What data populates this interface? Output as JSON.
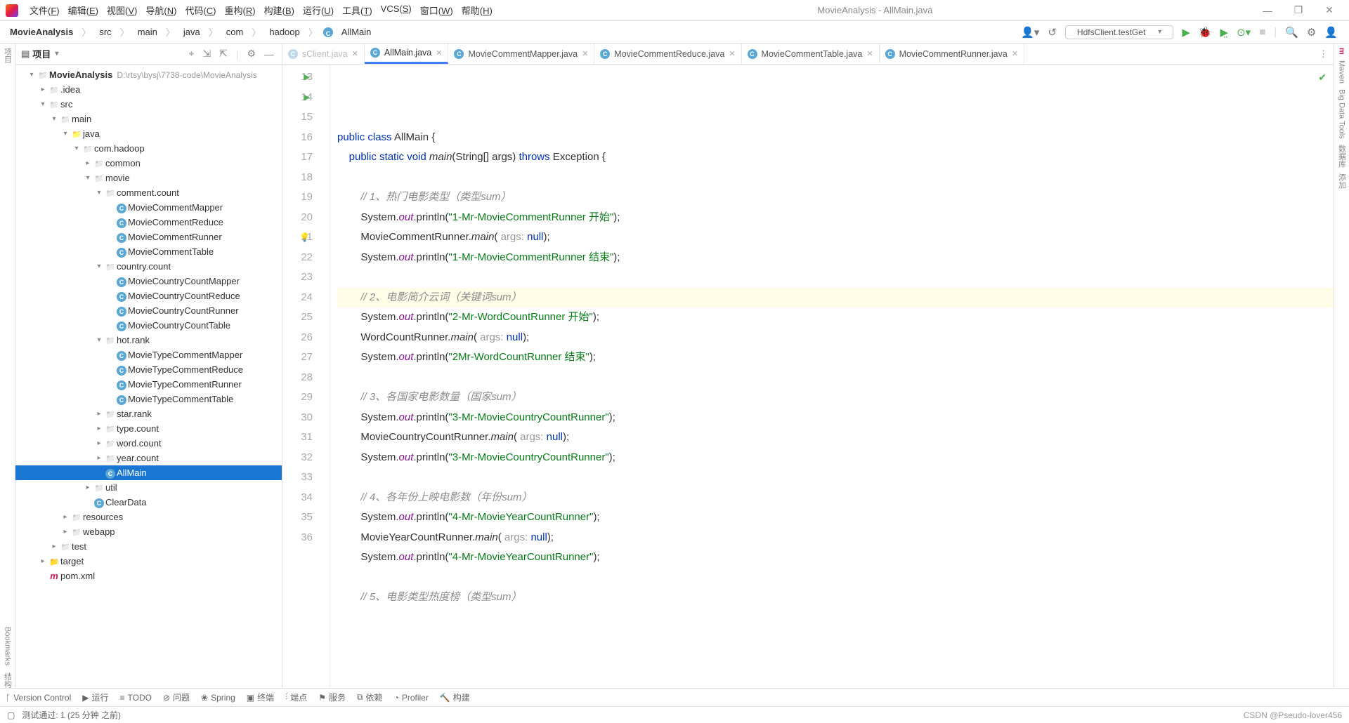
{
  "window": {
    "title": "MovieAnalysis - AllMain.java"
  },
  "menu": [
    "文件(F)",
    "编辑(E)",
    "视图(V)",
    "导航(N)",
    "代码(C)",
    "重构(R)",
    "构建(B)",
    "运行(U)",
    "工具(T)",
    "VCS(S)",
    "窗口(W)",
    "帮助(H)"
  ],
  "breadcrumbs": [
    "MovieAnalysis",
    "src",
    "main",
    "java",
    "com",
    "hadoop",
    "AllMain"
  ],
  "runConfig": "HdfsClient.testGet",
  "project": {
    "header": "项目",
    "root": {
      "name": "MovieAnalysis",
      "path": "D:\\rtsy\\bysj\\7738-code\\MovieAnalysis"
    },
    "tree": [
      {
        "d": 1,
        "a": "▾",
        "i": "fold",
        "t": "MovieAnalysis",
        "bold": true,
        "path": "D:\\rtsy\\bysj\\7738-code\\MovieAnalysis"
      },
      {
        "d": 2,
        "a": "▸",
        "i": "fold",
        "t": ".idea"
      },
      {
        "d": 2,
        "a": "▾",
        "i": "fold",
        "t": "src"
      },
      {
        "d": 3,
        "a": "▾",
        "i": "fold",
        "t": "main"
      },
      {
        "d": 4,
        "a": "▾",
        "i": "foldb",
        "t": "java"
      },
      {
        "d": 5,
        "a": "▾",
        "i": "fold",
        "t": "com.hadoop"
      },
      {
        "d": 6,
        "a": "▸",
        "i": "fold",
        "t": "common"
      },
      {
        "d": 6,
        "a": "▾",
        "i": "fold",
        "t": "movie"
      },
      {
        "d": 7,
        "a": "▾",
        "i": "fold",
        "t": "comment.count"
      },
      {
        "d": 8,
        "a": "",
        "i": "jcls",
        "t": "MovieCommentMapper"
      },
      {
        "d": 8,
        "a": "",
        "i": "jcls",
        "t": "MovieCommentReduce"
      },
      {
        "d": 8,
        "a": "",
        "i": "jcls",
        "t": "MovieCommentRunner"
      },
      {
        "d": 8,
        "a": "",
        "i": "jcls",
        "t": "MovieCommentTable"
      },
      {
        "d": 7,
        "a": "▾",
        "i": "fold",
        "t": "country.count"
      },
      {
        "d": 8,
        "a": "",
        "i": "jcls",
        "t": "MovieCountryCountMapper"
      },
      {
        "d": 8,
        "a": "",
        "i": "jcls",
        "t": "MovieCountryCountReduce"
      },
      {
        "d": 8,
        "a": "",
        "i": "jcls",
        "t": "MovieCountryCountRunner"
      },
      {
        "d": 8,
        "a": "",
        "i": "jcls",
        "t": "MovieCountryCountTable"
      },
      {
        "d": 7,
        "a": "▾",
        "i": "fold",
        "t": "hot.rank"
      },
      {
        "d": 8,
        "a": "",
        "i": "jcls",
        "t": "MovieTypeCommentMapper"
      },
      {
        "d": 8,
        "a": "",
        "i": "jcls",
        "t": "MovieTypeCommentReduce"
      },
      {
        "d": 8,
        "a": "",
        "i": "jcls",
        "t": "MovieTypeCommentRunner"
      },
      {
        "d": 8,
        "a": "",
        "i": "jcls",
        "t": "MovieTypeCommentTable"
      },
      {
        "d": 7,
        "a": "▸",
        "i": "fold",
        "t": "star.rank"
      },
      {
        "d": 7,
        "a": "▸",
        "i": "fold",
        "t": "type.count"
      },
      {
        "d": 7,
        "a": "▸",
        "i": "fold",
        "t": "word.count"
      },
      {
        "d": 7,
        "a": "▸",
        "i": "fold",
        "t": "year.count"
      },
      {
        "d": 7,
        "a": "",
        "i": "jcls",
        "t": "AllMain",
        "sel": true
      },
      {
        "d": 6,
        "a": "▸",
        "i": "fold",
        "t": "util"
      },
      {
        "d": 6,
        "a": "",
        "i": "jcls",
        "t": "ClearData"
      },
      {
        "d": 4,
        "a": "▸",
        "i": "fold",
        "t": "resources"
      },
      {
        "d": 4,
        "a": "▸",
        "i": "fold",
        "t": "webapp"
      },
      {
        "d": 3,
        "a": "▸",
        "i": "fold",
        "t": "test"
      },
      {
        "d": 2,
        "a": "▸",
        "i": "foldt",
        "t": "target"
      },
      {
        "d": 2,
        "a": "",
        "i": "mvn",
        "t": "pom.xml"
      }
    ]
  },
  "tabs": [
    {
      "label": "sClient.java",
      "fade": true
    },
    {
      "label": "AllMain.java",
      "active": true
    },
    {
      "label": "MovieCommentMapper.java"
    },
    {
      "label": "MovieCommentReduce.java"
    },
    {
      "label": "MovieCommentTable.java"
    },
    {
      "label": "MovieCommentRunner.java"
    }
  ],
  "code": {
    "start": 13,
    "lines": [
      {
        "n": 13,
        "run": true,
        "h": "<span class='kw'>public class</span> AllMain {"
      },
      {
        "n": 14,
        "run": true,
        "h": "    <span class='kw'>public static void</span> <span class='mth'>main</span>(String[] args) <span class='kw'>throws</span> Exception {"
      },
      {
        "n": 15,
        "h": ""
      },
      {
        "n": 16,
        "h": "        <span class='cm'>// 1、热门电影类型（类型sum）</span>"
      },
      {
        "n": 17,
        "h": "        System.<span class='fld'>out</span>.println(<span class='str'>\"1-Mr-MovieCommentRunner 开始\"</span>);"
      },
      {
        "n": 18,
        "h": "        MovieCommentRunner.<span class='mth'>main</span>( <span class='hint'>args:</span> <span class='kw'>null</span>);"
      },
      {
        "n": 19,
        "h": "        System.<span class='fld'>out</span>.println(<span class='str'>\"1-Mr-MovieCommentRunner 结束\"</span>);"
      },
      {
        "n": 20,
        "h": ""
      },
      {
        "n": 21,
        "bulb": true,
        "hl": true,
        "h": "        <span class='cm'>// 2、电影简介云词（关键词sum）</span>"
      },
      {
        "n": 22,
        "h": "        System.<span class='fld'>out</span>.println(<span class='str'>\"2-Mr-WordCountRunner 开始\"</span>);"
      },
      {
        "n": 23,
        "h": "        WordCountRunner.<span class='mth'>main</span>( <span class='hint'>args:</span> <span class='kw'>null</span>);"
      },
      {
        "n": 24,
        "h": "        System.<span class='fld'>out</span>.println(<span class='str'>\"2Mr-WordCountRunner 结束\"</span>);"
      },
      {
        "n": 25,
        "h": ""
      },
      {
        "n": 26,
        "h": "        <span class='cm'>// 3、各国家电影数量（国家sum）</span>"
      },
      {
        "n": 27,
        "h": "        System.<span class='fld'>out</span>.println(<span class='str'>\"3-Mr-MovieCountryCountRunner\"</span>);"
      },
      {
        "n": 28,
        "h": "        MovieCountryCountRunner.<span class='mth'>main</span>( <span class='hint'>args:</span> <span class='kw'>null</span>);"
      },
      {
        "n": 29,
        "h": "        System.<span class='fld'>out</span>.println(<span class='str'>\"3-Mr-MovieCountryCountRunner\"</span>);"
      },
      {
        "n": 30,
        "h": ""
      },
      {
        "n": 31,
        "h": "        <span class='cm'>// 4、各年份上映电影数（年份sum）</span>"
      },
      {
        "n": 32,
        "h": "        System.<span class='fld'>out</span>.println(<span class='str'>\"4-Mr-MovieYearCountRunner\"</span>);"
      },
      {
        "n": 33,
        "h": "        MovieYearCountRunner.<span class='mth'>main</span>( <span class='hint'>args:</span> <span class='kw'>null</span>);"
      },
      {
        "n": 34,
        "h": "        System.<span class='fld'>out</span>.println(<span class='str'>\"4-Mr-MovieYearCountRunner\"</span>);"
      },
      {
        "n": 35,
        "h": ""
      },
      {
        "n": 36,
        "h": "        <span class='cm'>// 5、电影类型热度榜（类型sum）</span>"
      }
    ]
  },
  "leftTools": [
    "项目",
    "Bookmarks",
    "结构"
  ],
  "rightTools": [
    "Maven",
    "Big Data Tools",
    "数据库",
    "添加"
  ],
  "bottomTabs": [
    "Version Control",
    "运行",
    "TODO",
    "问题",
    "Spring",
    "终端",
    "端点",
    "服务",
    "依赖",
    "Profiler",
    "构建"
  ],
  "status": {
    "msg": "测试通过: 1 (25 分钟 之前)",
    "watermark": "CSDN @Pseudo-lover456"
  }
}
